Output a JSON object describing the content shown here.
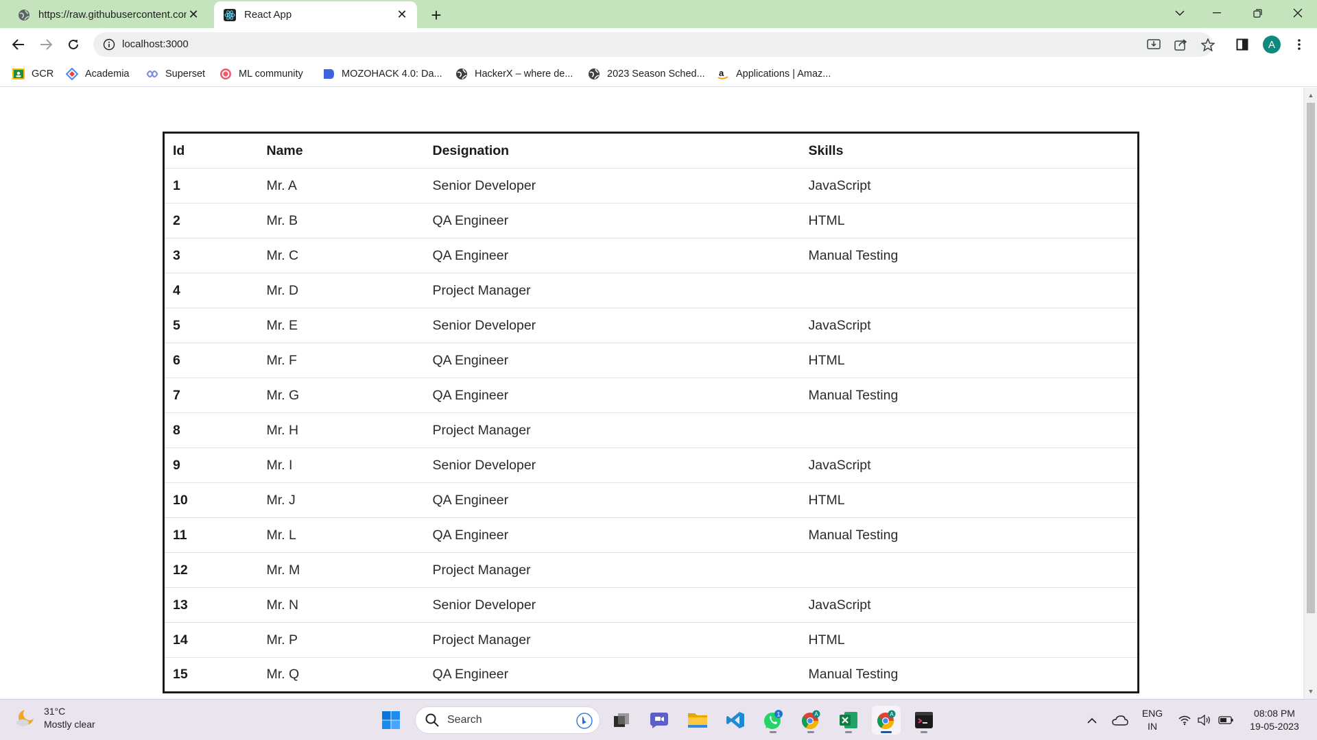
{
  "browser": {
    "tabs": [
      {
        "title": "https://raw.githubusercontent.com",
        "favicon": "globe-icon",
        "active": false
      },
      {
        "title": "React App",
        "favicon": "react-icon",
        "active": true
      }
    ],
    "url": "localhost:3000",
    "profile_initial": "A",
    "accent": "#c5e4bd"
  },
  "bookmarks": [
    {
      "label": "GCR",
      "icon": "classroom-icon"
    },
    {
      "label": "Academia",
      "icon": "academia-icon"
    },
    {
      "label": "Superset",
      "icon": "superset-icon"
    },
    {
      "label": "ML community",
      "icon": "ml-community-icon"
    },
    {
      "label": "MOZOHACK 4.0: Da...",
      "icon": "mozohack-icon"
    },
    {
      "label": "HackerX – where de...",
      "icon": "globe-icon"
    },
    {
      "label": "2023 Season Sched...",
      "icon": "globe-icon"
    },
    {
      "label": "Applications | Amaz...",
      "icon": "amazon-icon"
    }
  ],
  "table": {
    "headers": [
      "Id",
      "Name",
      "Designation",
      "Skills"
    ],
    "rows": [
      {
        "id": "1",
        "name": "Mr. A",
        "designation": "Senior Developer",
        "skills": "JavaScript"
      },
      {
        "id": "2",
        "name": "Mr. B",
        "designation": "QA Engineer",
        "skills": "HTML"
      },
      {
        "id": "3",
        "name": "Mr. C",
        "designation": "QA Engineer",
        "skills": "Manual Testing"
      },
      {
        "id": "4",
        "name": "Mr. D",
        "designation": "Project Manager",
        "skills": ""
      },
      {
        "id": "5",
        "name": "Mr. E",
        "designation": "Senior Developer",
        "skills": "JavaScript"
      },
      {
        "id": "6",
        "name": "Mr. F",
        "designation": "QA Engineer",
        "skills": "HTML"
      },
      {
        "id": "7",
        "name": "Mr. G",
        "designation": "QA Engineer",
        "skills": "Manual Testing"
      },
      {
        "id": "8",
        "name": "Mr. H",
        "designation": "Project Manager",
        "skills": ""
      },
      {
        "id": "9",
        "name": "Mr. I",
        "designation": "Senior Developer",
        "skills": "JavaScript"
      },
      {
        "id": "10",
        "name": "Mr. J",
        "designation": "QA Engineer",
        "skills": "HTML"
      },
      {
        "id": "11",
        "name": "Mr. L",
        "designation": "QA Engineer",
        "skills": "Manual Testing"
      },
      {
        "id": "12",
        "name": "Mr. M",
        "designation": "Project Manager",
        "skills": ""
      },
      {
        "id": "13",
        "name": "Mr. N",
        "designation": "Senior Developer",
        "skills": "JavaScript"
      },
      {
        "id": "14",
        "name": "Mr. P",
        "designation": "Project Manager",
        "skills": "HTML"
      },
      {
        "id": "15",
        "name": "Mr. Q",
        "designation": "QA Engineer",
        "skills": "Manual Testing"
      }
    ]
  },
  "taskbar": {
    "weather_temp": "31°C",
    "weather_desc": "Mostly clear",
    "search_placeholder": "Search",
    "whatsapp_badge": "1",
    "language": "ENG",
    "region": "IN",
    "time": "08:08 PM",
    "date": "19-05-2023"
  }
}
